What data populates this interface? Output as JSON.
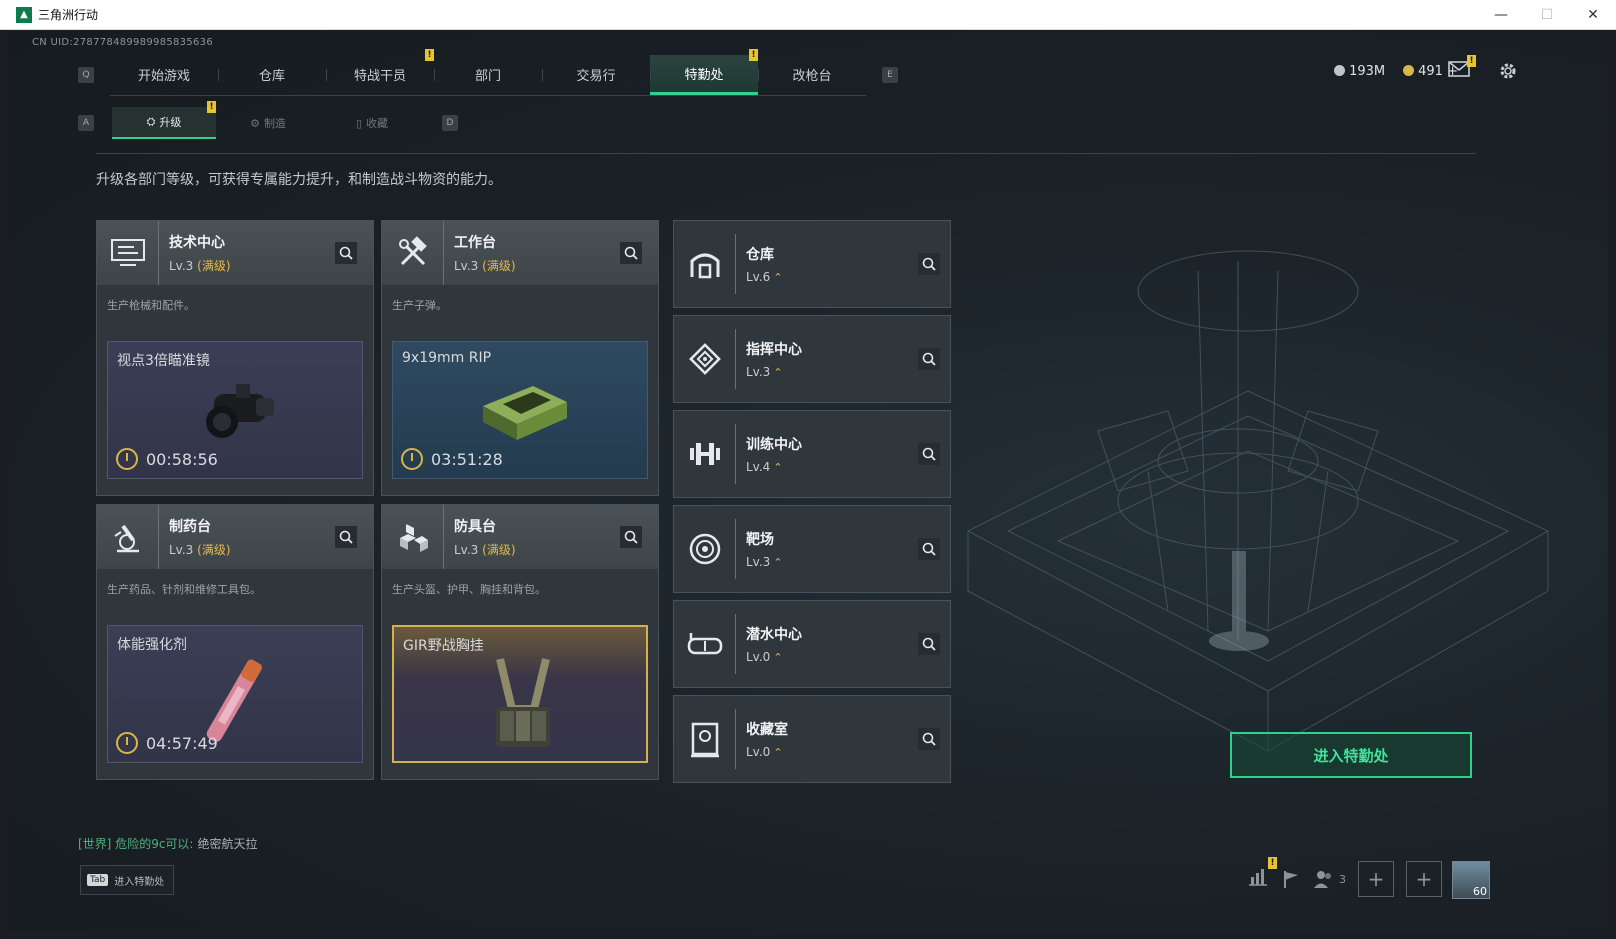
{
  "window": {
    "title": "三角洲行动",
    "minimize": "—",
    "maximize": "☐",
    "close": "✕"
  },
  "uid": "CN UID:278778489989985835636",
  "nav": {
    "left_key": "Q",
    "right_key": "E",
    "tabs": [
      {
        "label": "开始游戏"
      },
      {
        "label": "仓库"
      },
      {
        "label": "特战干员"
      },
      {
        "label": "部门"
      },
      {
        "label": "交易行"
      },
      {
        "label": "特勤处",
        "active": true
      },
      {
        "label": "改枪台"
      }
    ]
  },
  "currency": {
    "silver": "193M",
    "gold": "491",
    "gold_add": "+"
  },
  "subnav": {
    "left_key": "A",
    "right_key": "D",
    "tabs": [
      {
        "label": "升级",
        "active": true
      },
      {
        "label": "制造"
      },
      {
        "label": "收藏"
      }
    ]
  },
  "description": "升级各部门等级，可获得专属能力提升，和制造战斗物资的能力。",
  "production_cards": [
    {
      "icon": "computer-icon",
      "name": "技术中心",
      "level": "Lv.3",
      "max": "(满级)",
      "desc": "生产枪械和配件。",
      "item": "视点3倍瞄准镜",
      "timer": "00:58:56"
    },
    {
      "icon": "hammer-wrench-icon",
      "name": "工作台",
      "level": "Lv.3",
      "max": "(满级)",
      "desc": "生产子弹。",
      "item": "9x19mm RIP",
      "timer": "03:51:28"
    },
    {
      "icon": "microscope-icon",
      "name": "制药台",
      "level": "Lv.3",
      "max": "(满级)",
      "desc": "生产药品、针剂和维修工具包。",
      "item": "体能强化剂",
      "timer": "04:57:49"
    },
    {
      "icon": "armor-blocks-icon",
      "name": "防具台",
      "level": "Lv.3",
      "max": "(满级)",
      "desc": "生产头盔、护甲、胸挂和背包。",
      "item": "GIR野战胸挂",
      "timer": ""
    }
  ],
  "facilities": [
    {
      "icon": "warehouse-icon",
      "name": "仓库",
      "level": "Lv.6"
    },
    {
      "icon": "command-center-icon",
      "name": "指挥中心",
      "level": "Lv.3"
    },
    {
      "icon": "dumbbell-icon",
      "name": "训练中心",
      "level": "Lv.4"
    },
    {
      "icon": "target-icon",
      "name": "靶场",
      "level": "Lv.3"
    },
    {
      "icon": "diving-mask-icon",
      "name": "潜水中心",
      "level": "Lv.0"
    },
    {
      "icon": "vault-icon",
      "name": "收藏室",
      "level": "Lv.0"
    }
  ],
  "enter_button": "进入特勤处",
  "chat": {
    "channel": "[世界]",
    "sender": "危险的9c可以:",
    "message": "绝密航天拉"
  },
  "tab_hint": {
    "key": "Tab",
    "label": "进入特勤处"
  },
  "bottom": {
    "party_count": "3",
    "player_level": "60"
  },
  "colors": {
    "accent": "#2fd28c",
    "gold": "#e4b94a",
    "badge": "#e7c530"
  }
}
